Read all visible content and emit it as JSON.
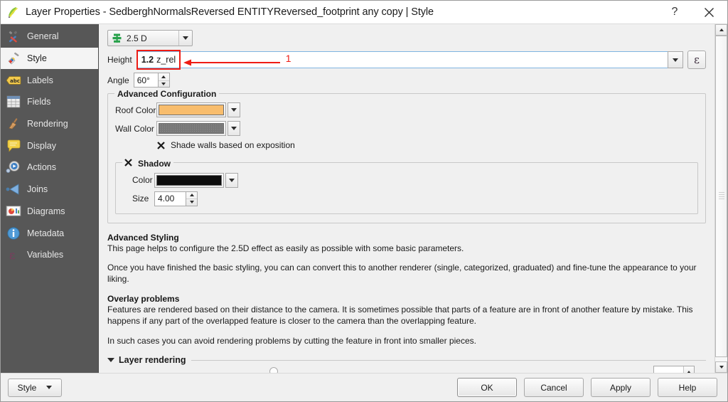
{
  "window": {
    "title": "Layer Properties - SedberghNormalsReversed ENTITYReversed_footprint any copy | Style",
    "icon": "qgis-logo-icon",
    "help_label": "?",
    "close_label": "✕"
  },
  "sidebar": {
    "items": [
      {
        "label": "General",
        "icon": "wrench-screwdriver-icon",
        "selected": false
      },
      {
        "label": "Style",
        "icon": "paintbrush-icon",
        "selected": true
      },
      {
        "label": "Labels",
        "icon": "abc-label-icon",
        "selected": false
      },
      {
        "label": "Fields",
        "icon": "table-grid-icon",
        "selected": false
      },
      {
        "label": "Rendering",
        "icon": "broom-icon",
        "selected": false
      },
      {
        "label": "Display",
        "icon": "speech-bubble-icon",
        "selected": false
      },
      {
        "label": "Actions",
        "icon": "gear-play-icon",
        "selected": false
      },
      {
        "label": "Joins",
        "icon": "join-arrow-icon",
        "selected": false
      },
      {
        "label": "Diagrams",
        "icon": "diagram-chart-icon",
        "selected": false
      },
      {
        "label": "Metadata",
        "icon": "info-circle-icon",
        "selected": false
      },
      {
        "label": "Variables",
        "icon": "epsilon-icon",
        "selected": false
      }
    ]
  },
  "style_panel": {
    "renderer": {
      "label": "2.5 D",
      "icon": "layers-25d-icon"
    },
    "height": {
      "label": "Height",
      "value_number": "1.2",
      "value_field": "z_rel",
      "override_button": "ε",
      "override_name": "data-defined-override"
    },
    "angle": {
      "label": "Angle",
      "value": "60°"
    },
    "annotation": {
      "number": "1",
      "color": "#ee1c15"
    },
    "advanced_configuration": {
      "title": "Advanced Configuration",
      "roof_color": {
        "label": "Roof Color",
        "color": "#f8bd6d"
      },
      "wall_color": {
        "label": "Wall Color",
        "color": "#787878"
      },
      "shade_walls": {
        "label": "Shade walls based on exposition",
        "checked": true
      },
      "shadow": {
        "title": "Shadow",
        "checked": true,
        "color": {
          "label": "Color",
          "color": "#0d0d0d"
        },
        "size": {
          "label": "Size",
          "value": "4.00"
        }
      }
    },
    "help": {
      "heading_1": "Advanced Styling",
      "paragraph_1": "This page helps to configure the 2.5D effect as easily as possible with some basic parameters.",
      "paragraph_2": "Once you have finished the basic styling, you can can convert this to another renderer (single, categorized, graduated) and fine-tune the appearance to your liking.",
      "heading_2": "Overlay problems",
      "paragraph_3": "Features are rendered based on their distance to the camera. It is sometimes possible that parts of a feature are in front of another feature by mistake. This happens if any part of the overlapped feature is closer to the camera than the overlapping feature.",
      "paragraph_4": "In such cases you can avoid rendering problems by cutting the feature in front into smaller pieces."
    },
    "layer_rendering": {
      "label": "Layer rendering",
      "expanded": true
    }
  },
  "bottom_bar": {
    "style_menu": "Style",
    "ok": "OK",
    "cancel": "Cancel",
    "apply": "Apply",
    "help": "Help"
  }
}
